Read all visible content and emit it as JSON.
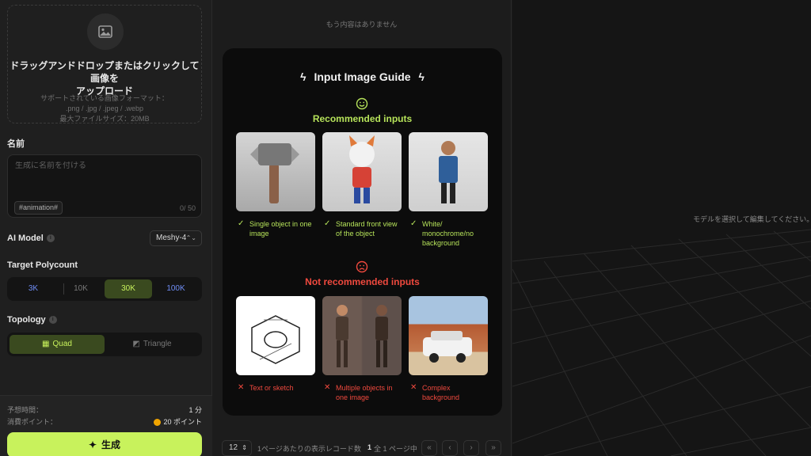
{
  "upload": {
    "title_line1": "ドラッグアンドドロップまたはクリックして画像を",
    "title_line2": "アップロード",
    "supported_label": "サポートされている画像フォーマット：",
    "formats": ".png / .jpg / .jpeg / .webp",
    "max_size": "最大ファイルサイズ：20MB",
    "icon": "image-icon"
  },
  "name": {
    "label": "名前",
    "placeholder": "生成に名前を付ける",
    "tag": "#animation#",
    "counter": "0/ 50"
  },
  "ai_model": {
    "label": "AI Model",
    "value": "Meshy-4"
  },
  "polycount": {
    "label": "Target Polycount",
    "options": [
      "3K",
      "10K",
      "30K",
      "100K"
    ],
    "selected": "30K"
  },
  "topology": {
    "label": "Topology",
    "options": [
      "Quad",
      "Triangle"
    ],
    "selected": "Quad"
  },
  "footer": {
    "time_label": "予想時間：",
    "time_value": "1 分",
    "points_label": "消費ポイント：",
    "points_value": "20 ポイント",
    "generate_label": "生成"
  },
  "middle": {
    "no_more": "もう内容はありません"
  },
  "guide": {
    "title": "Input Image Guide",
    "recommended": {
      "title": "Recommended inputs",
      "color": "#b6e35a",
      "items": [
        {
          "caption": "Single object in one image"
        },
        {
          "caption": "Standard front view of the object"
        },
        {
          "caption": "White/ monochrome/no background"
        }
      ]
    },
    "not_recommended": {
      "title": "Not recommended inputs",
      "color": "#f0493e",
      "items": [
        {
          "caption": "Text or sketch"
        },
        {
          "caption": "Multiple objects in one image"
        },
        {
          "caption": "Complex background"
        }
      ]
    }
  },
  "pager": {
    "page_size": "12",
    "page_size_label": "1ページあたりの表示レコード数",
    "page_current": "1",
    "page_info": "全 1 ページ中"
  },
  "viewer": {
    "hint": "モデルを選択して編集してください。"
  },
  "colors": {
    "accent": "#c8f25c",
    "panel": "#1f1f1f",
    "guide_bg": "#0c0c0c"
  }
}
